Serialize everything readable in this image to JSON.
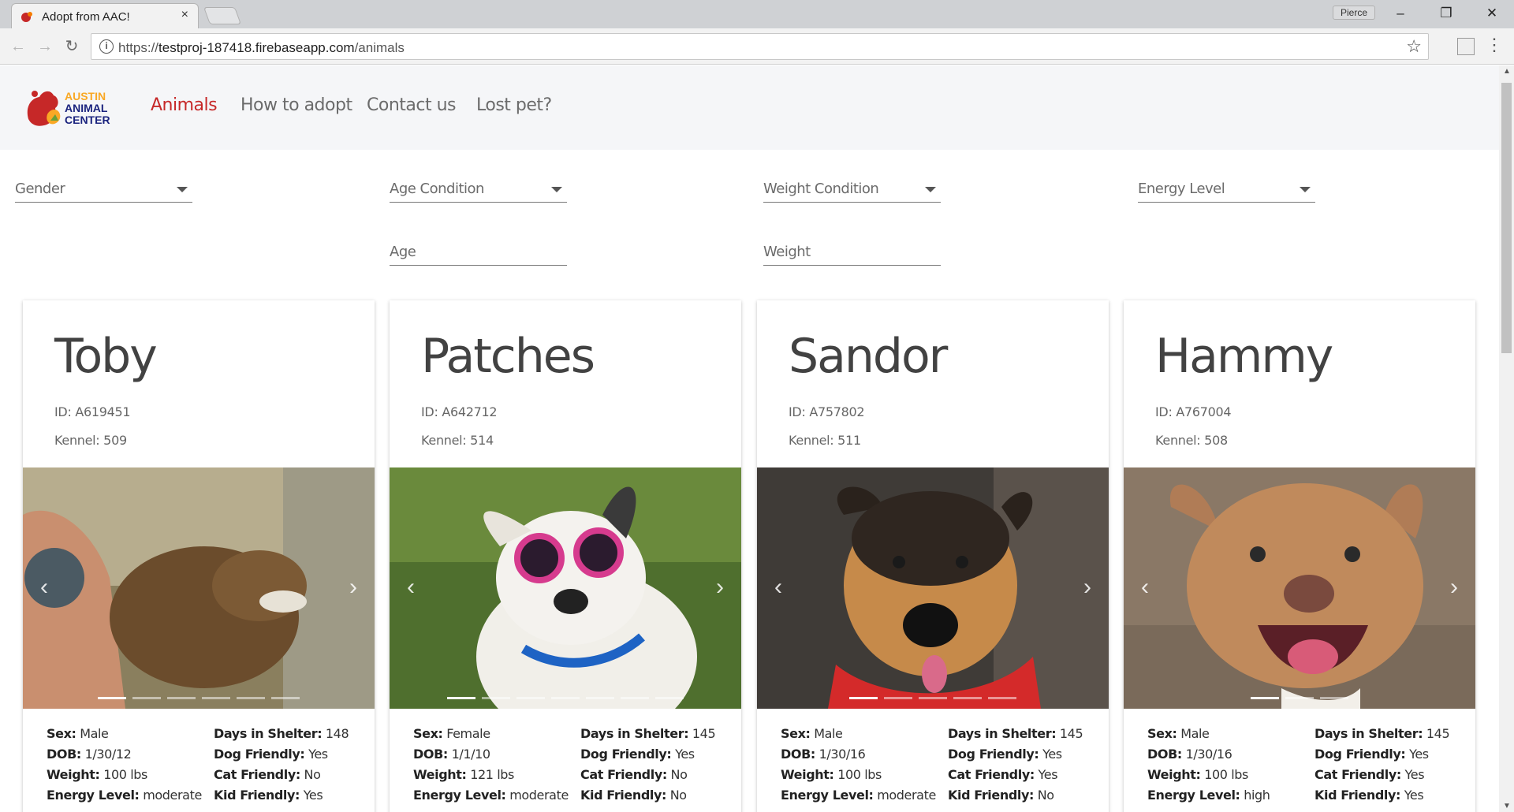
{
  "browser": {
    "tab_title": "Adopt from AAC!",
    "tab_close": "×",
    "profile_name": "Pierce",
    "url_prefix": "https://",
    "url_host": "testproj-187418.firebaseapp.com",
    "url_path": "/animals",
    "minimize": "–",
    "restore": "❐",
    "close": "✕",
    "back": "←",
    "forward": "→",
    "reload": "↻",
    "star": "☆",
    "menu": "⋮",
    "info": "i"
  },
  "site": {
    "logo_text": [
      "AUSTIN",
      "ANIMAL",
      "CENTER"
    ],
    "nav": [
      {
        "label": "Animals",
        "active": true
      },
      {
        "label": "How to adopt",
        "active": false
      },
      {
        "label": "Contact us",
        "active": false
      },
      {
        "label": "Lost pet?",
        "active": false
      }
    ],
    "accent_color": "#c62828"
  },
  "filters": {
    "gender": "Gender",
    "age_condition": "Age Condition",
    "weight_condition": "Weight Condition",
    "energy_level": "Energy Level",
    "age": "Age",
    "weight": "Weight"
  },
  "labels": {
    "id_prefix": "ID: ",
    "kennel_prefix": "Kennel: ",
    "sex": "Sex:",
    "dob": "DOB:",
    "weight": "Weight:",
    "energy": "Energy Level:",
    "days": "Days in Shelter:",
    "dog": "Dog Friendly:",
    "cat": "Cat Friendly:",
    "kid": "Kid Friendly:",
    "prev": "‹",
    "next": "›"
  },
  "animals": [
    {
      "name": "Toby",
      "id": "ID: A619451",
      "kennel": "Kennel: 509",
      "sex": "Male",
      "dob": "1/30/12",
      "weight": "100 lbs",
      "energy": "moderate",
      "days": "148",
      "dog": "Yes",
      "cat": "No",
      "kid": "Yes",
      "slides": 6,
      "active_slide": 0
    },
    {
      "name": "Patches",
      "id": "ID: A642712",
      "kennel": "Kennel: 514",
      "sex": "Female",
      "dob": "1/1/10",
      "weight": "121 lbs",
      "energy": "moderate",
      "days": "145",
      "dog": "Yes",
      "cat": "No",
      "kid": "No",
      "slides": 7,
      "active_slide": 0
    },
    {
      "name": "Sandor",
      "id": "ID: A757802",
      "kennel": "Kennel: 511",
      "sex": "Male",
      "dob": "1/30/16",
      "weight": "100 lbs",
      "energy": "moderate",
      "days": "145",
      "dog": "Yes",
      "cat": "Yes",
      "kid": "No",
      "slides": 5,
      "active_slide": 0
    },
    {
      "name": "Hammy",
      "id": "ID: A767004",
      "kennel": "Kennel: 508",
      "sex": "Male",
      "dob": "1/30/16",
      "weight": "100 lbs",
      "energy": "high",
      "days": "145",
      "dog": "Yes",
      "cat": "Yes",
      "kid": "Yes",
      "slides": 3,
      "active_slide": 0
    }
  ]
}
